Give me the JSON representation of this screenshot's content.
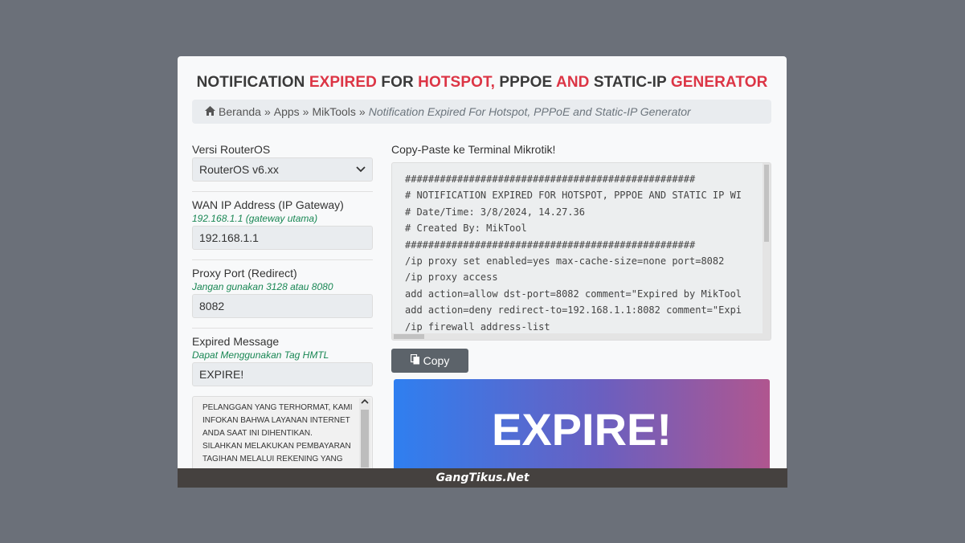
{
  "page": {
    "title_parts": [
      {
        "text": "NOTIFICATION ",
        "red": false
      },
      {
        "text": "EXPIRED",
        "red": true
      },
      {
        "text": " FOR ",
        "red": false
      },
      {
        "text": "HOTSPOT,",
        "red": true
      },
      {
        "text": " PPPOE ",
        "red": false
      },
      {
        "text": "AND",
        "red": true
      },
      {
        "text": " STATIC-IP ",
        "red": false
      },
      {
        "text": "GENERATOR",
        "red": true
      }
    ]
  },
  "breadcrumb": {
    "home_icon": "home-icon",
    "items": [
      "Beranda",
      "Apps",
      "MikTools"
    ],
    "separator": "»",
    "current": "Notification Expired For Hotspot, PPPoE and Static-IP Generator"
  },
  "form": {
    "routeros_label": "Versi RouterOS",
    "routeros_value": "RouterOS v6.xx",
    "wan_label": "WAN IP Address (IP Gateway)",
    "wan_hint": "192.168.1.1 (gateway utama)",
    "wan_value": "192.168.1.1",
    "proxy_label": "Proxy Port (Redirect)",
    "proxy_hint": "Jangan gunakan 3128 atau 8080",
    "proxy_value": "8082",
    "msg_label": "Expired Message",
    "msg_hint": "Dapat Menggunakan Tag HMTL",
    "msg_value": "EXPIRE!",
    "textarea": "PELANGGAN YANG TERHORMAT, KAMI INFOKAN BAHWA LAYANAN INTERNET ANDA SAAT INI DIHENTIKAN. SILAHKAN MELAKUKAN PEMBAYARAN TAGIHAN MELALUI REKENING YANG"
  },
  "terminal": {
    "label": "Copy-Paste ke Terminal Mikrotik!",
    "lines": [
      "##################################################",
      "# NOTIFICATION EXPIRED FOR HOTSPOT, PPPOE AND STATIC IP WI",
      "# Date/Time: 3/8/2024, 14.27.36",
      "# Created By: MikTool",
      "##################################################",
      "/ip proxy set enabled=yes max-cache-size=none port=8082",
      "/ip proxy access",
      "add action=allow dst-port=8082 comment=\"Expired by MikTool",
      "add action=deny redirect-to=192.168.1.1:8082 comment=\"Expi",
      "/ip firewall address-list"
    ],
    "copy_label": "Copy",
    "copy_icon": "copy-icon"
  },
  "preview": {
    "text": "EXPIRE!"
  },
  "watermark": "GangTikus.Net"
}
